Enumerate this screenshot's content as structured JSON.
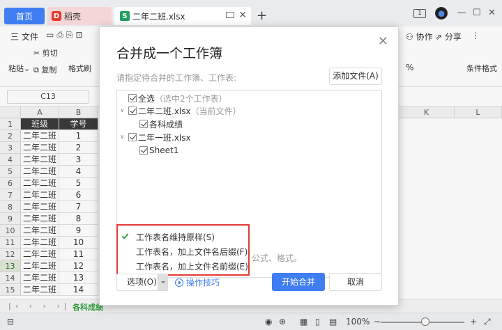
{
  "titlebar": {
    "tab_home": "首页",
    "tab_daoke": "稻壳",
    "tab_file": "二年二班.xlsx",
    "tab_add": "+"
  },
  "ribbon": {
    "menu_file": "三 文件",
    "cut": "剪切",
    "paste": "粘贴",
    "copy": "复制",
    "format_painter": "格式刷",
    "collab": "协作",
    "share": "分享",
    "percent": "%",
    "conditional_format": "条件格式"
  },
  "formula": {
    "namebox": "C13"
  },
  "grid": {
    "columns": [
      "A",
      "B"
    ],
    "right_columns": [
      "K",
      "L"
    ],
    "rows": [
      {
        "n": "1",
        "a": "班级",
        "b": "学号"
      },
      {
        "n": "2",
        "a": "二年二班",
        "b": "1"
      },
      {
        "n": "3",
        "a": "二年二班",
        "b": "2"
      },
      {
        "n": "4",
        "a": "二年二班",
        "b": "3"
      },
      {
        "n": "5",
        "a": "二年二班",
        "b": "4"
      },
      {
        "n": "6",
        "a": "二年二班",
        "b": "5"
      },
      {
        "n": "7",
        "a": "二年二班",
        "b": "6"
      },
      {
        "n": "8",
        "a": "二年二班",
        "b": "7"
      },
      {
        "n": "9",
        "a": "二年二班",
        "b": "8"
      },
      {
        "n": "10",
        "a": "二年二班",
        "b": "9"
      },
      {
        "n": "11",
        "a": "二年二班",
        "b": "10"
      },
      {
        "n": "12",
        "a": "二年二班",
        "b": "11"
      },
      {
        "n": "13",
        "a": "二年二班",
        "b": "12"
      },
      {
        "n": "14",
        "a": "二年二班",
        "b": "13"
      },
      {
        "n": "15",
        "a": "二年二班",
        "b": "14"
      }
    ]
  },
  "sheetbar": {
    "sheet_tab": "各科成绩"
  },
  "statusbar": {
    "zoom": "100%"
  },
  "dialog": {
    "title": "合并成一个工作簿",
    "description": "请指定待合并的工作簿、工作表:",
    "add_file": "添加文件(A)",
    "tree": {
      "select_all": "全选",
      "select_all_note": "（选中2个工作表）",
      "file1": "二年二班.xlsx",
      "file1_note": "（当前文件）",
      "file1_sheet": "各科成绩",
      "file2": "二年一班.xlsx",
      "file2_sheet": "Sheet1"
    },
    "dropdown": [
      "工作表名维持原样(S)",
      "工作表名，加上文件名后缀(F)",
      "工作表名，加上文件名前缀(E)"
    ],
    "hint_tail": "公式、格式。",
    "options": "选项(O)",
    "tips": "操作技巧",
    "merge": "开始合并",
    "cancel": "取消"
  }
}
